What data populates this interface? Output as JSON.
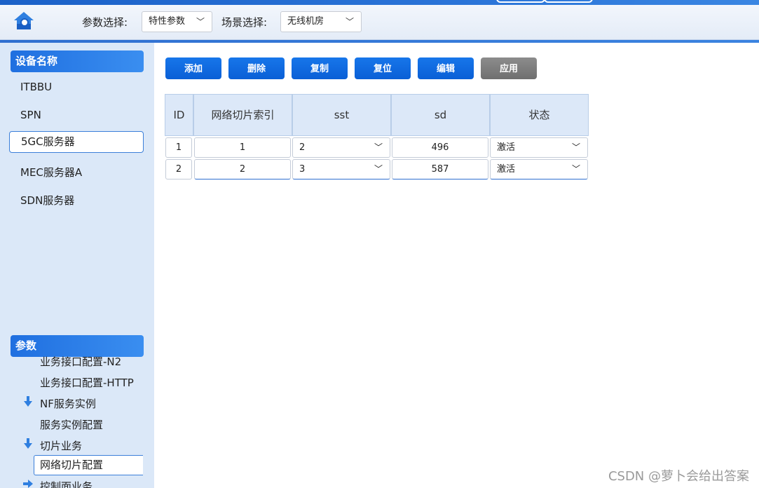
{
  "header": {
    "param_label": "参数选择:",
    "param_value": "特性参数",
    "scene_label": "场景选择:",
    "scene_value": "无线机房"
  },
  "sidebar": {
    "devices_title": "设备名称",
    "devices": [
      "ITBBU",
      "SPN",
      "5GC服务器",
      "MEC服务器A",
      "SDN服务器"
    ],
    "selected_device": "5GC服务器",
    "params_title": "参数",
    "params": [
      {
        "label": "业务接口配置-N2",
        "type": "item"
      },
      {
        "label": "业务接口配置-HTTP",
        "type": "item"
      },
      {
        "label": "NF服务实例",
        "type": "group"
      },
      {
        "label": "服务实例配置",
        "type": "item"
      },
      {
        "label": "切片业务",
        "type": "group"
      },
      {
        "label": "网络切片配置",
        "type": "item",
        "selected": true
      },
      {
        "label": "控制面业务",
        "type": "group"
      }
    ]
  },
  "toolbar": {
    "add": "添加",
    "delete": "删除",
    "copy": "复制",
    "reset": "复位",
    "edit": "编辑",
    "apply": "应用"
  },
  "table": {
    "headers": [
      "ID",
      "网络切片索引",
      "sst",
      "sd",
      "状态"
    ],
    "rows": [
      {
        "id": "1",
        "index": "1",
        "sst": "2",
        "sd": "496",
        "status": "激活"
      },
      {
        "id": "2",
        "index": "2",
        "sst": "3",
        "sd": "587",
        "status": "激活"
      }
    ]
  },
  "watermark": "CSDN @萝卜会给出答案",
  "colors": {
    "accent": "#0a5fd6",
    "sidebar_bg": "#dbe8f8",
    "header_cell_bg": "#dce8f8",
    "disabled_button": "#7a7a7a"
  }
}
